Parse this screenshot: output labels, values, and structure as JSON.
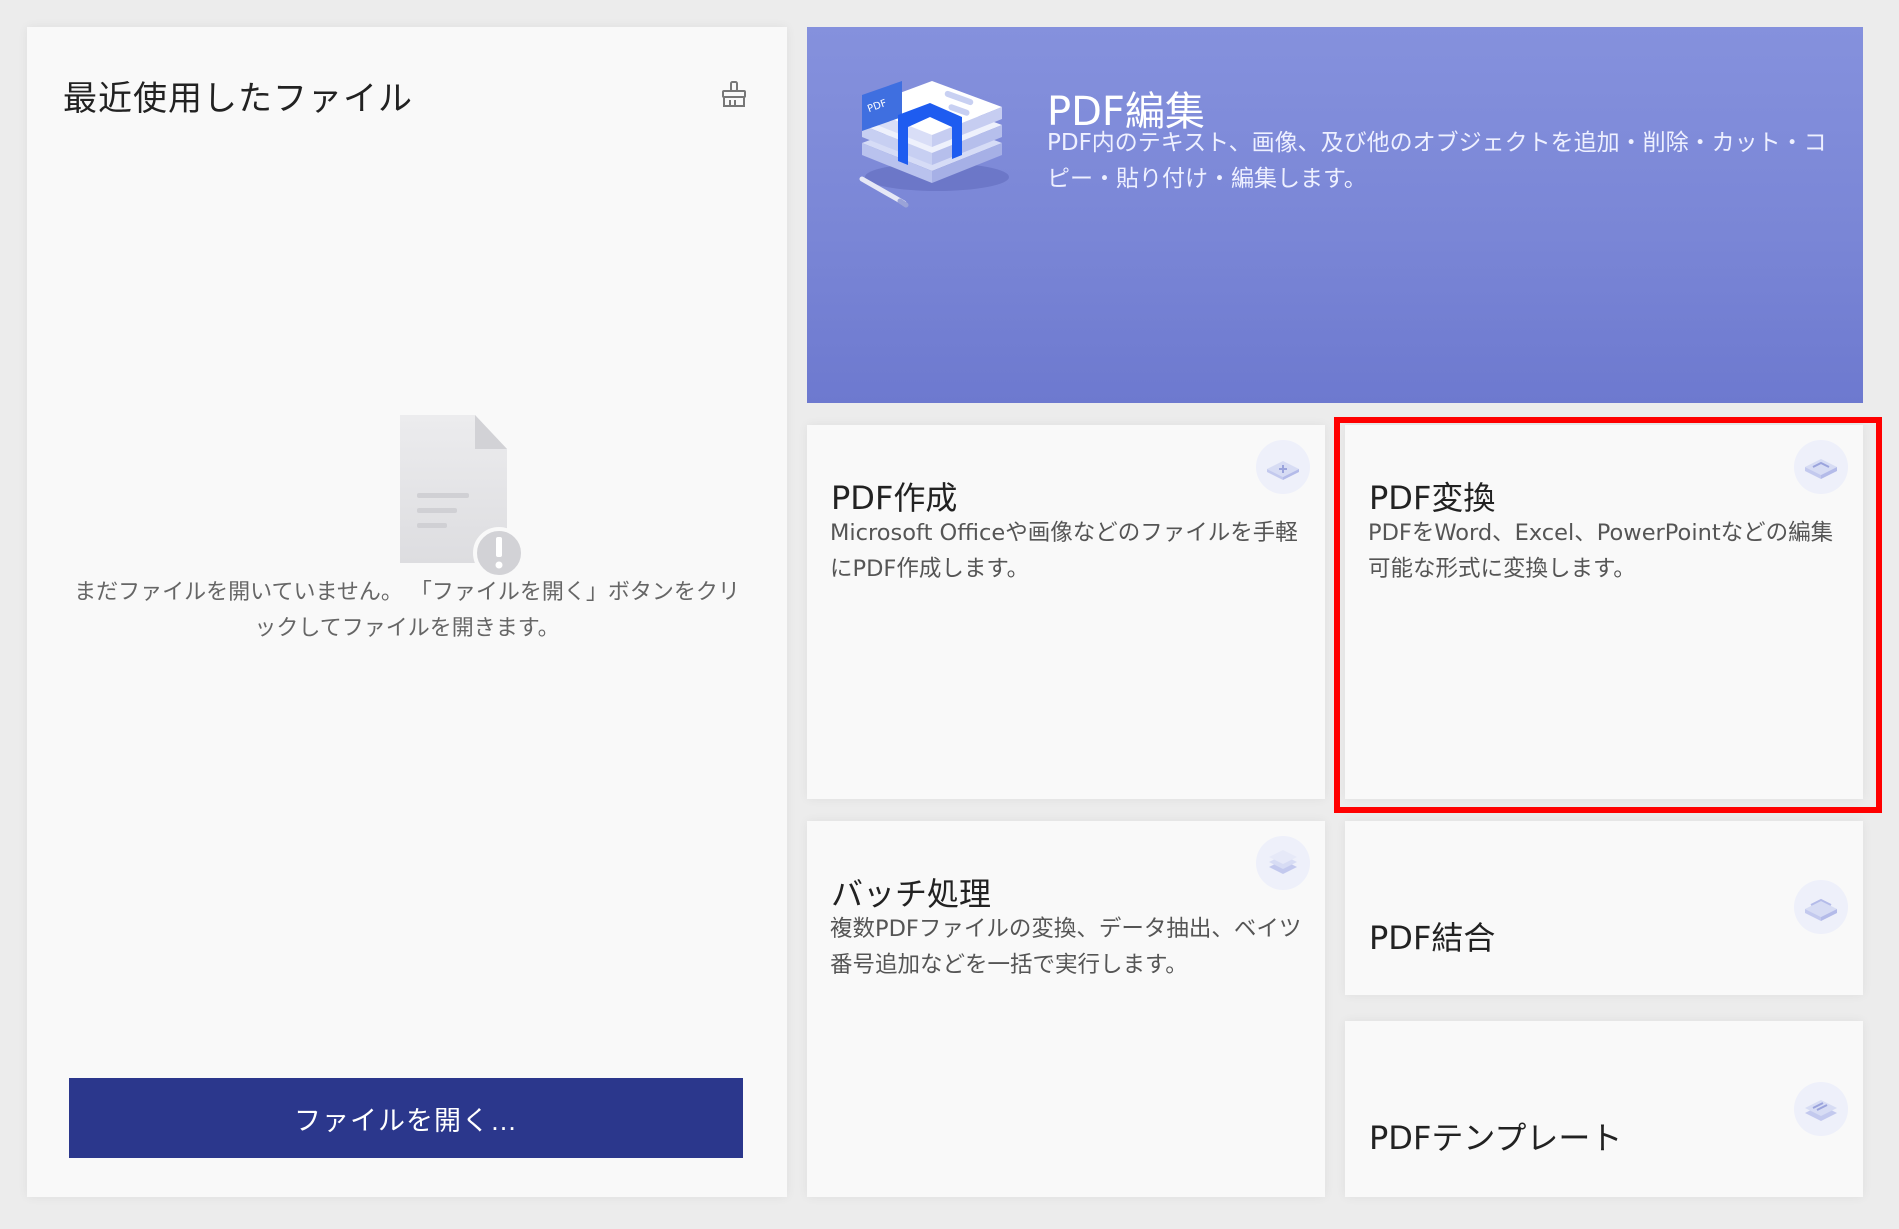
{
  "recent": {
    "title": "最近使用したファイル",
    "clean_icon": "broom-icon",
    "empty_icon": "empty-document-warning-icon",
    "empty_text": "まだファイルを開いていません。 「ファイルを開く」ボタンをクリックしてファイルを開きます。",
    "open_button": "ファイルを開く…"
  },
  "features": {
    "edit": {
      "title": "PDF編集",
      "desc": "PDF内のテキスト、画像、及び他のオブジェクトを追加・削除・カット・コピー・貼り付け・編集します。",
      "icon": "pdf-edit-illustration"
    },
    "create": {
      "title": "PDF作成",
      "desc": "Microsoft Officeや画像などのファイルを手軽にPDF作成します。",
      "icon": "pdf-create-icon"
    },
    "convert": {
      "title": "PDF変換",
      "desc": "PDFをWord、Excel、PowerPointなどの編集可能な形式に変換します。",
      "icon": "pdf-convert-icon"
    },
    "batch": {
      "title": "バッチ処理",
      "desc": "複数PDFファイルの変換、データ抽出、ベイツ番号追加などを一括で実行します。",
      "icon": "batch-process-icon"
    },
    "combine": {
      "title": "PDF結合",
      "icon": "pdf-combine-icon"
    },
    "template": {
      "title": "PDFテンプレート",
      "icon": "pdf-template-icon"
    }
  },
  "colors": {
    "background": "#ececec",
    "card": "#f9f9f9",
    "primary_button": "#2b378c",
    "hero_gradient_top": "#8591dd",
    "hero_gradient_bottom": "#6d79cf",
    "highlight": "#ff0000"
  }
}
